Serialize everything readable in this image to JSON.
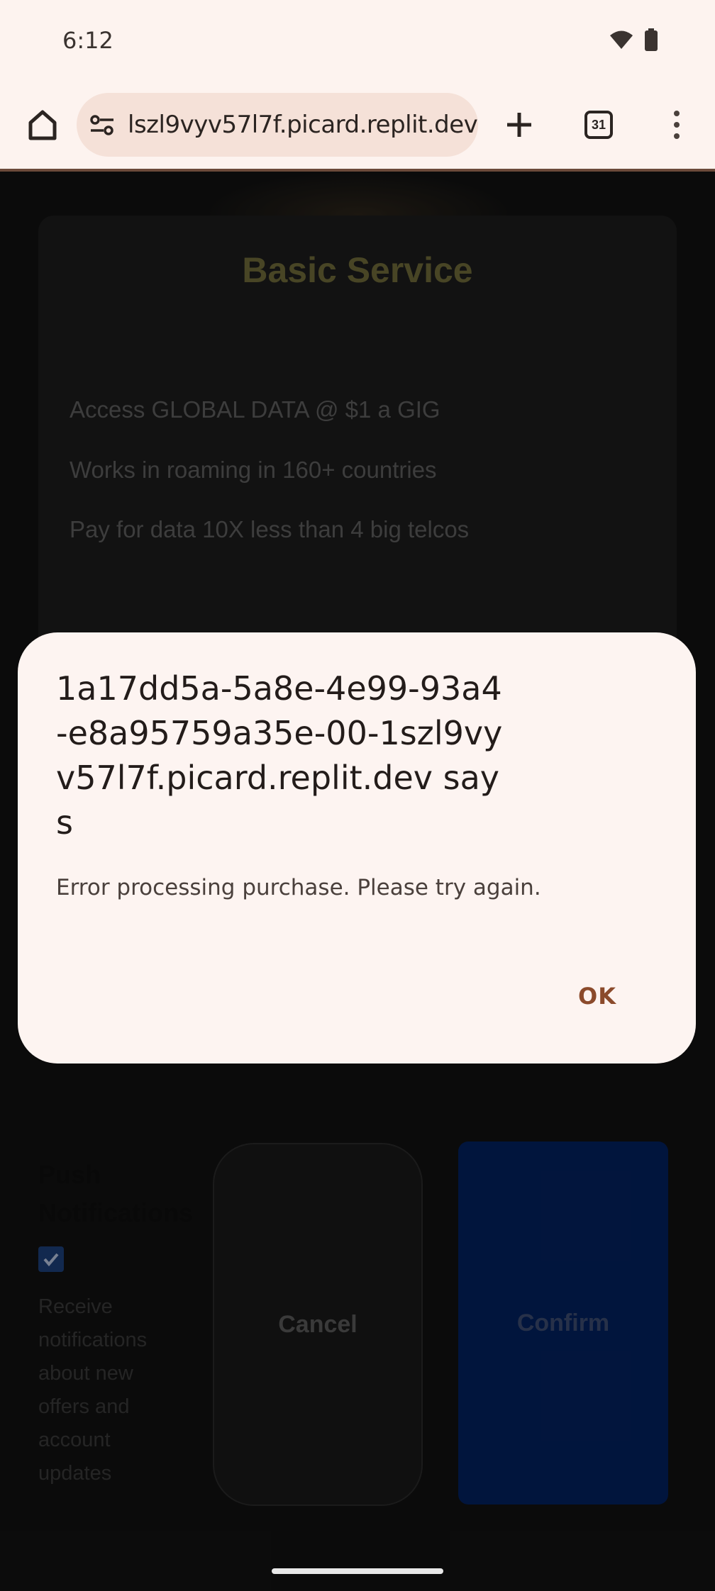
{
  "status": {
    "time": "6:12"
  },
  "browser": {
    "url": "lszl9vyv57l7f.picard.replit.dev",
    "tab_count": "31"
  },
  "page": {
    "service_title": "Basic Service",
    "features": [
      "Access GLOBAL DATA @ $1 a GIG",
      "Works in roaming in 160+ countries",
      "Pay for data 10X less than 4 big telcos"
    ],
    "push_title": "Push Notifications",
    "push_desc": "Receive notifications about new offers and account updates",
    "cancel_label": "Cancel",
    "confirm_label": "Confirm"
  },
  "dialog": {
    "title": "1a17dd5a-5a8e-4e99-93a4-e8a95759a35e-00-1szl9vyv57l7f.picard.replit.dev says",
    "message": "Error processing purchase. Please try again.",
    "ok_label": "OK"
  }
}
